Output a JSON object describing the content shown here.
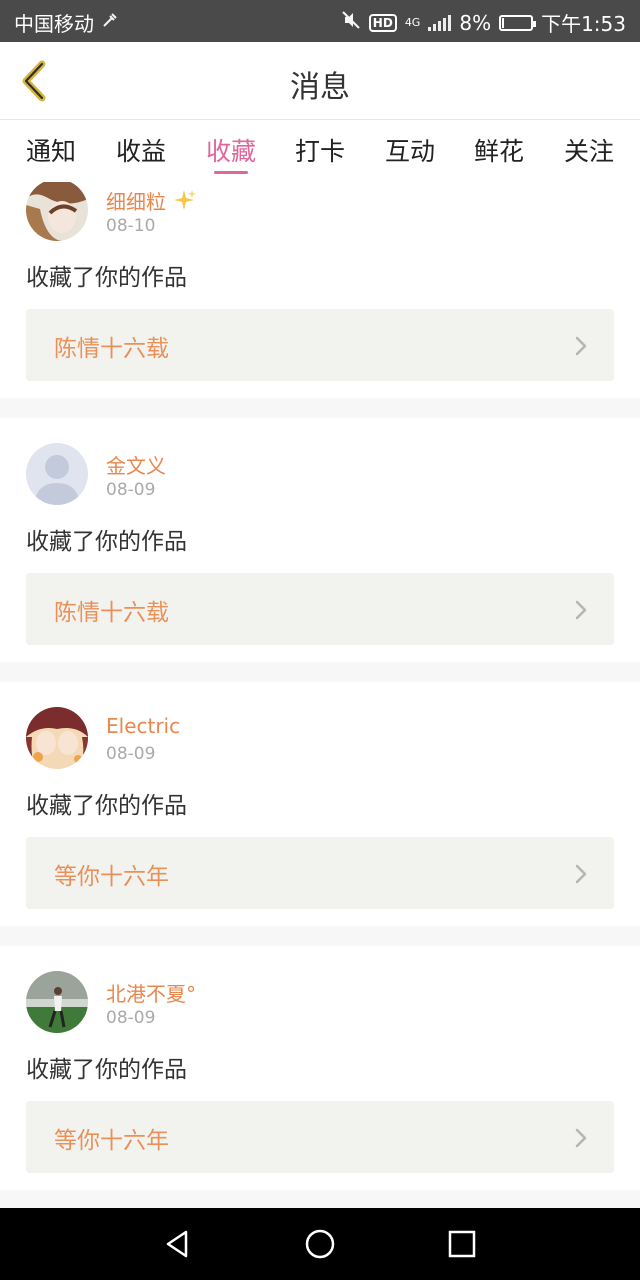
{
  "status_bar": {
    "carrier": "中国移动",
    "network": "4G",
    "battery": "8%",
    "battery_level": 0.08,
    "time": "下午1:53"
  },
  "header": {
    "title": "消息",
    "back_icon": "back-chevron-icon"
  },
  "tabs": [
    {
      "label": "通知",
      "active": false
    },
    {
      "label": "收益",
      "active": false
    },
    {
      "label": "收藏",
      "active": true
    },
    {
      "label": "打卡",
      "active": false
    },
    {
      "label": "互动",
      "active": false
    },
    {
      "label": "鲜花",
      "active": false
    },
    {
      "label": "关注",
      "active": false
    }
  ],
  "feed": [
    {
      "username": "细细粒",
      "date": "08-10",
      "action": "收藏了你的作品",
      "work": "陈情十六载",
      "sparkle": true
    },
    {
      "username": "金文义",
      "date": "08-09",
      "action": "收藏了你的作品",
      "work": "陈情十六载",
      "sparkle": false
    },
    {
      "username": "Electric",
      "date": "08-09",
      "action": "收藏了你的作品",
      "work": "等你十六年",
      "sparkle": false
    },
    {
      "username": "北港不夏°",
      "date": "08-09",
      "action": "收藏了你的作品",
      "work": "等你十六年",
      "sparkle": false
    }
  ],
  "colors": {
    "accent": "#e0679c",
    "username": "#e9874f",
    "work_title": "#ea915a",
    "work_bg": "#f2f3ef",
    "status_bar": "#4a4a4a"
  }
}
